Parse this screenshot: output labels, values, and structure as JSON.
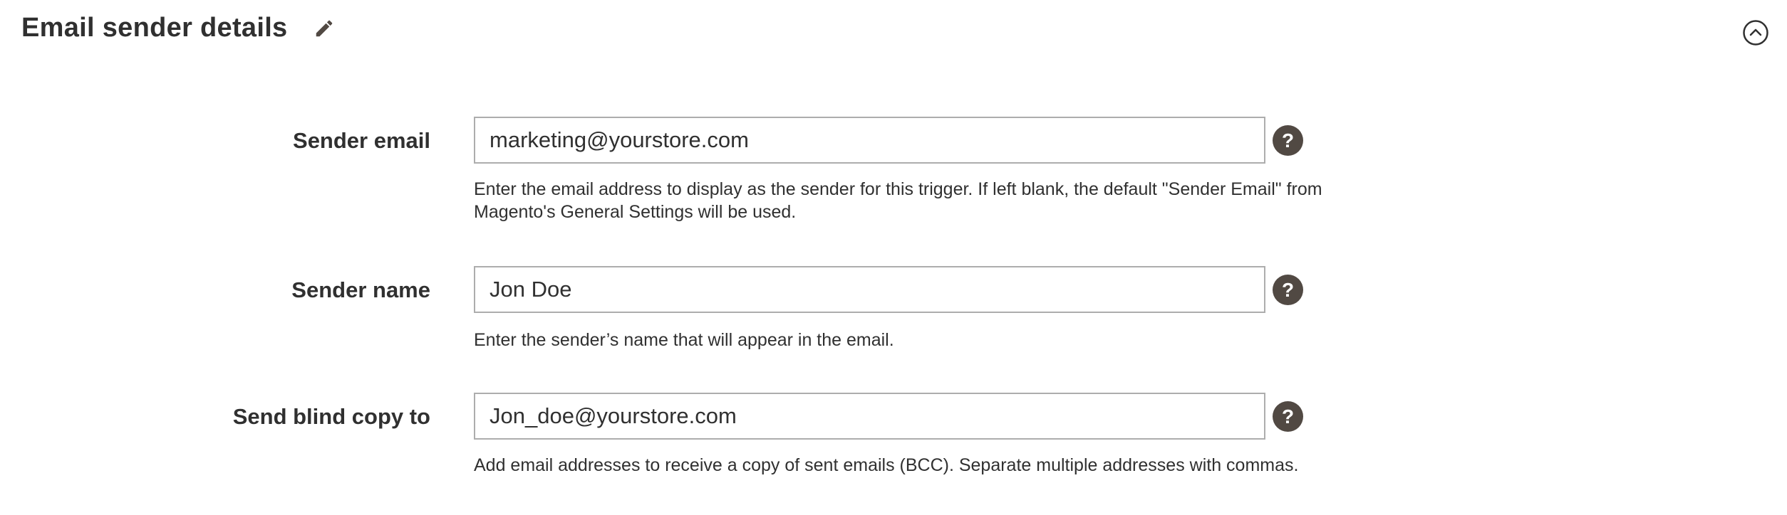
{
  "section": {
    "title": "Email sender details",
    "icons": {
      "edit": "pencil-icon",
      "collapse": "chevron-up-circle-icon"
    }
  },
  "fields": [
    {
      "label": "Sender email",
      "value": "marketing@yourstore.com",
      "note": "Enter the email address to display as the sender for this trigger. If left blank, the default \"Sender Email\" from Magento's General Settings will be used."
    },
    {
      "label": "Sender name",
      "value": "Jon Doe",
      "note": "Enter the sender’s name that will appear in the email."
    },
    {
      "label": "Send blind copy to",
      "value": "Jon_doe@yourstore.com",
      "note": "Add email addresses to receive a copy of sent emails (BCC). Separate multiple addresses with commas."
    }
  ],
  "colors": {
    "text": "#303030",
    "input_border": "#adadad",
    "help_icon_bg": "#514943",
    "background": "#ffffff"
  }
}
